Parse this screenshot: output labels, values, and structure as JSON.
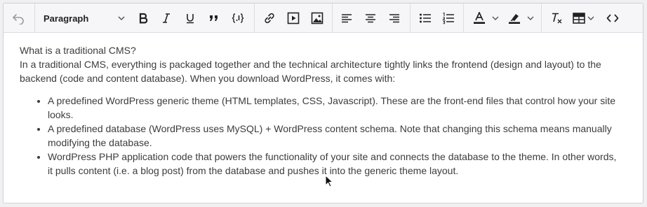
{
  "toolbar": {
    "block_format": "Paragraph",
    "icons": [
      "undo-icon",
      "bold-icon",
      "italic-icon",
      "underline-icon",
      "blockquote-icon",
      "code-block-icon",
      "link-icon",
      "media-icon",
      "image-icon",
      "align-left-icon",
      "align-center-icon",
      "align-right-icon",
      "bullet-list-icon",
      "numbered-list-icon",
      "text-color-icon",
      "highlight-color-icon",
      "clear-formatting-icon",
      "table-icon",
      "source-code-icon"
    ],
    "text_color": "#111111",
    "highlight_color": "#111111"
  },
  "content": {
    "heading": "What is a traditional CMS?",
    "intro": "In a traditional CMS, everything is packaged together and the technical architecture tightly links the frontend (design and layout) to the backend (code and content database). When you download WordPress, it comes with:",
    "list": [
      "A predefined WordPress generic theme (HTML templates, CSS, Javascript). These are the front-end files that control how your site looks.",
      "A predefined database (WordPress uses MySQL) + WordPress content schema. Note that changing this schema means manually modifying the database.",
      "WordPress PHP application code that powers the functionality of your site and connects the database to the theme. In other words, it pulls content (i.e. a blog post) from the database and pushes it into the generic theme layout."
    ]
  }
}
